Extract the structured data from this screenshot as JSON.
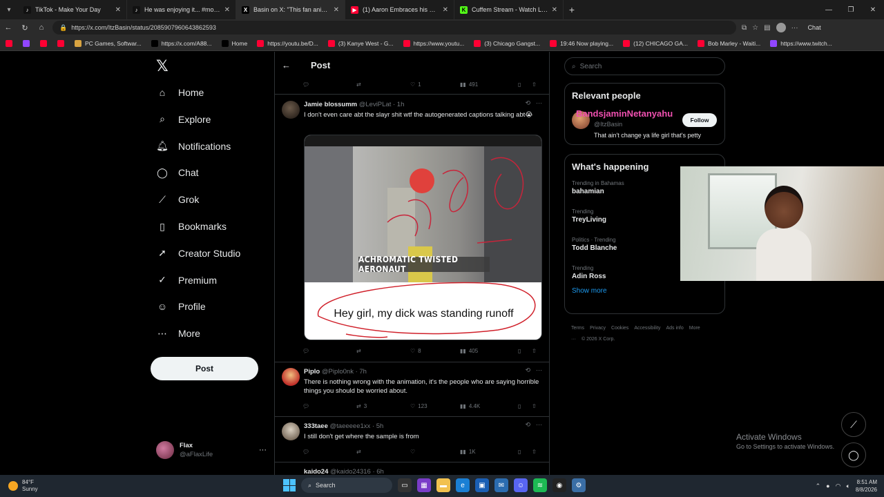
{
  "browser": {
    "tabs": [
      {
        "label": "TikTok - Make Your Day",
        "color": "#111111",
        "glyph": "♪"
      },
      {
        "label": "He was enjoying it... #momlife #b",
        "color": "#111111",
        "glyph": "♪"
      },
      {
        "label": "Basin on X: \"This fan animation di",
        "color": "#000000",
        "glyph": "X",
        "active": true
      },
      {
        "label": "(1) Aaron Embraces his Roots | Ati",
        "color": "#ff0033",
        "glyph": "▶"
      },
      {
        "label": "Cuffem Stream - Watch Live on Kic",
        "color": "#53fc18",
        "glyph": "K"
      }
    ],
    "url": "https://x.com/ItzBasin/status/2085907960643862593",
    "chat_label": "Chat",
    "bookmarks": [
      {
        "label": "",
        "color": "#ff0033"
      },
      {
        "label": "",
        "color": "#9146ff"
      },
      {
        "label": "",
        "color": "#ff0033"
      },
      {
        "label": "",
        "color": "#ff0033"
      },
      {
        "label": "PC Games, Softwar...",
        "color": "#d9a441"
      },
      {
        "label": "https://x.com/A88...",
        "color": "#000000"
      },
      {
        "label": "Home",
        "color": "#000000"
      },
      {
        "label": "https://youtu.be/D...",
        "color": "#ff0033"
      },
      {
        "label": "(3) Kanye West - G...",
        "color": "#ff0033"
      },
      {
        "label": "https://www.youtu...",
        "color": "#ff0033"
      },
      {
        "label": "(3) Chicago Gangst...",
        "color": "#ff0033"
      },
      {
        "label": "19:46 Now playing...",
        "color": "#ff0033"
      },
      {
        "label": "(12) CHICAGO GA...",
        "color": "#ff0033"
      },
      {
        "label": "Bob Marley - Waiti...",
        "color": "#ff0033"
      },
      {
        "label": "https://www.twitch...",
        "color": "#9146ff"
      }
    ]
  },
  "nav": {
    "items": [
      {
        "label": "Home",
        "icon": "home-icon"
      },
      {
        "label": "Explore",
        "icon": "search-icon"
      },
      {
        "label": "Notifications",
        "icon": "bell-icon"
      },
      {
        "label": "Chat",
        "icon": "chat-icon"
      },
      {
        "label": "Grok",
        "icon": "grok-icon"
      },
      {
        "label": "Bookmarks",
        "icon": "bookmark-icon"
      },
      {
        "label": "Creator Studio",
        "icon": "rocket-icon"
      },
      {
        "label": "Premium",
        "icon": "verified-icon"
      },
      {
        "label": "Profile",
        "icon": "person-icon"
      },
      {
        "label": "More",
        "icon": "more-circle-icon"
      }
    ],
    "post_label": "Post",
    "account": {
      "name": "Flax",
      "handle": "@aFlaxLife"
    }
  },
  "center": {
    "title": "Post",
    "top_actions": {
      "likes": "1",
      "views": "491"
    },
    "tweets": [
      {
        "name": "Jamie blossumm",
        "handle": "@LeviPLat · 1h",
        "text": "I don't even care abt the slayr shit wtf the autogenerated captions talking abt😭",
        "media_caption": "ACHROMATIC TWISTED AERONAUT",
        "media_joke": "Hey girl, my dick was standing runoff",
        "retweets": "",
        "likes": "8",
        "views": "405"
      },
      {
        "name": "Piplo",
        "handle": "@Piplo0nk · 7h",
        "text": "There is nothing wrong with the animation, it's the people who are saying horrible things  you should be worried about.",
        "retweets": "3",
        "likes": "123",
        "views": "4.4K"
      },
      {
        "name": "333taee",
        "handle": "@taeeeee1xx · 5h",
        "text": "I still don't get where the sample is from",
        "retweets": "",
        "likes": "",
        "views": "1K"
      },
      {
        "name": "kaido24",
        "handle": "@kaido24316 · 6h"
      }
    ]
  },
  "right": {
    "search_placeholder": "Search",
    "relevant_title": "Relevant people",
    "relevant": {
      "name": "BandsjaminNetanyahu",
      "handle": "@ItzBasin",
      "bio": "That ain't change ya life girl that's petty",
      "follow_label": "Follow"
    },
    "happening_title": "What's happening",
    "trends": [
      {
        "context": "Trending in Bahamas",
        "name": "bahamian"
      },
      {
        "context": "Trending",
        "name": "TreyLiving"
      },
      {
        "context": "Politics · Trending",
        "name": "Todd Blanche"
      },
      {
        "context": "Trending",
        "name": "Adin Ross"
      }
    ],
    "show_more": "Show more",
    "footer": [
      "Terms",
      "Privacy",
      "Cookies",
      "Accessibility",
      "Ads info",
      "More ···",
      "© 2026 X Corp."
    ]
  },
  "overlay": {
    "activate_title": "Activate Windows",
    "activate_sub": "Go to Settings to activate Windows."
  },
  "taskbar": {
    "temp": "84°F",
    "condition": "Sunny",
    "search_label": "Search",
    "time": "8:51 AM",
    "date": "8/8/2026"
  }
}
